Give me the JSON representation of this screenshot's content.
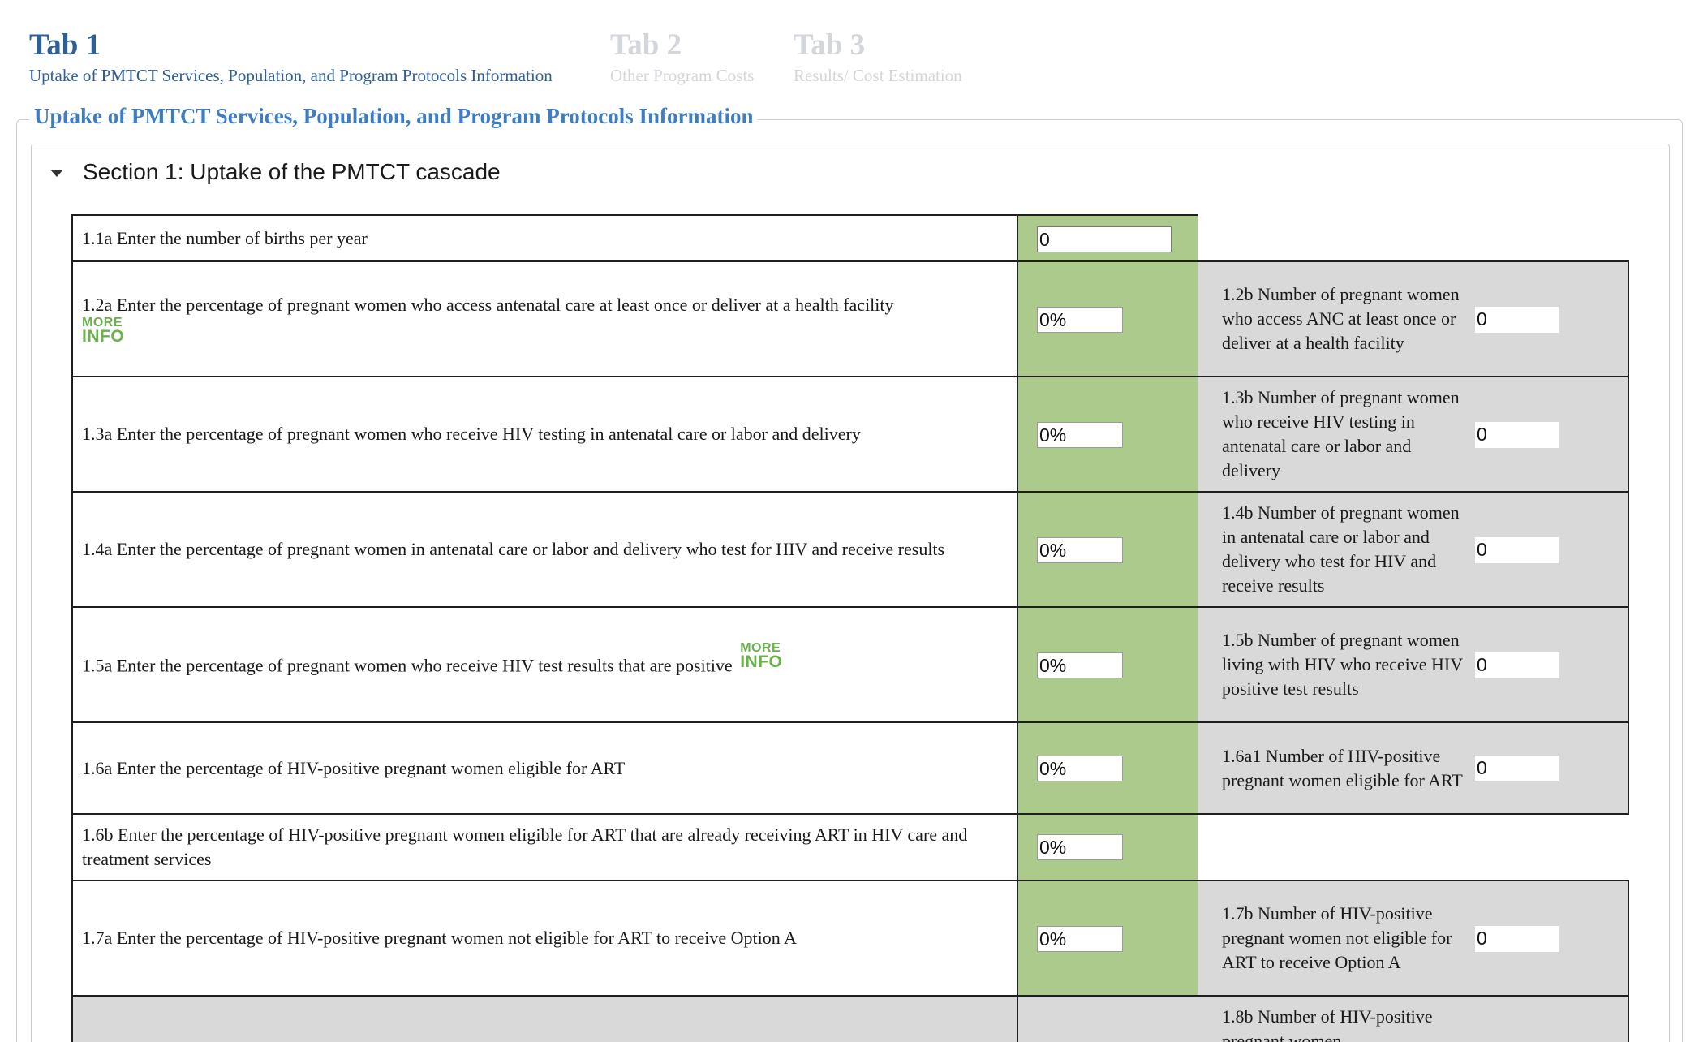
{
  "tabs": [
    {
      "title": "Tab 1",
      "subtitle": "Uptake of PMTCT Services, Population, and Program Protocols Information",
      "active": true
    },
    {
      "title": "Tab 2",
      "subtitle": "Other Program Costs",
      "active": false
    },
    {
      "title": "Tab 3",
      "subtitle": "Results/ Cost Estimation",
      "active": false
    }
  ],
  "fieldset_legend": "Uptake of PMTCT Services, Population, and Program Protocols Information",
  "section": {
    "title": "Section 1: Uptake of the PMTCT cascade",
    "expanded": true
  },
  "more_info": {
    "top": "MORE",
    "bottom": "INFO"
  },
  "colors": {
    "tab_active": "#2e5f97",
    "tab_inactive": "#d3d6da",
    "legend": "#3f7cc0",
    "input_column": "#abca8b",
    "derived_column": "#d9d9d9",
    "more_info": "#6ab04c"
  },
  "rows": [
    {
      "question": "1.1a Enter the number of births per year",
      "value": "0"
    },
    {
      "question": "1.2a Enter the percentage of pregnant women who access antenatal care at least once or deliver at a health facility",
      "value": "0%",
      "derived_label": "1.2b Number of pregnant women who access ANC at least once or deliver at a health facility",
      "derived_value": "0"
    },
    {
      "question": "1.3a Enter the percentage of pregnant women who receive HIV testing in antenatal care or labor and delivery",
      "value": "0%",
      "derived_label": "1.3b Number of pregnant women who receive HIV testing in antenatal care or labor and delivery",
      "derived_value": "0"
    },
    {
      "question": "1.4a Enter the percentage of pregnant women in antenatal care or labor and delivery who test for HIV and receive results",
      "value": "0%",
      "derived_label": "1.4b Number of pregnant women in antenatal care or labor and delivery who test for HIV and receive results",
      "derived_value": "0"
    },
    {
      "question": "1.5a Enter the percentage of pregnant women who receive HIV test results that are positive",
      "value": "0%",
      "derived_label": "1.5b Number of pregnant women living with HIV who receive HIV positive test results",
      "derived_value": "0"
    },
    {
      "question": "1.6a Enter the percentage of HIV-positive pregnant women eligible for ART",
      "value": "0%",
      "derived_label": "1.6a1 Number of HIV-positive pregnant women eligible for ART",
      "derived_value": "0"
    },
    {
      "question": "1.6b Enter the percentage of HIV-positive pregnant women eligible for ART that are already receiving ART in HIV care and treatment services",
      "value": "0%"
    },
    {
      "question": "1.7a Enter the percentage of HIV-positive pregnant women not eligible for ART to receive Option A",
      "value": "0%",
      "derived_label": "1.7b Number of HIV-positive pregnant women not eligible for ART to receive Option A",
      "derived_value": "0"
    },
    {
      "question": "",
      "value": "",
      "derived_label": "1.8b Number of HIV-positive pregnant women",
      "derived_value": ""
    }
  ]
}
